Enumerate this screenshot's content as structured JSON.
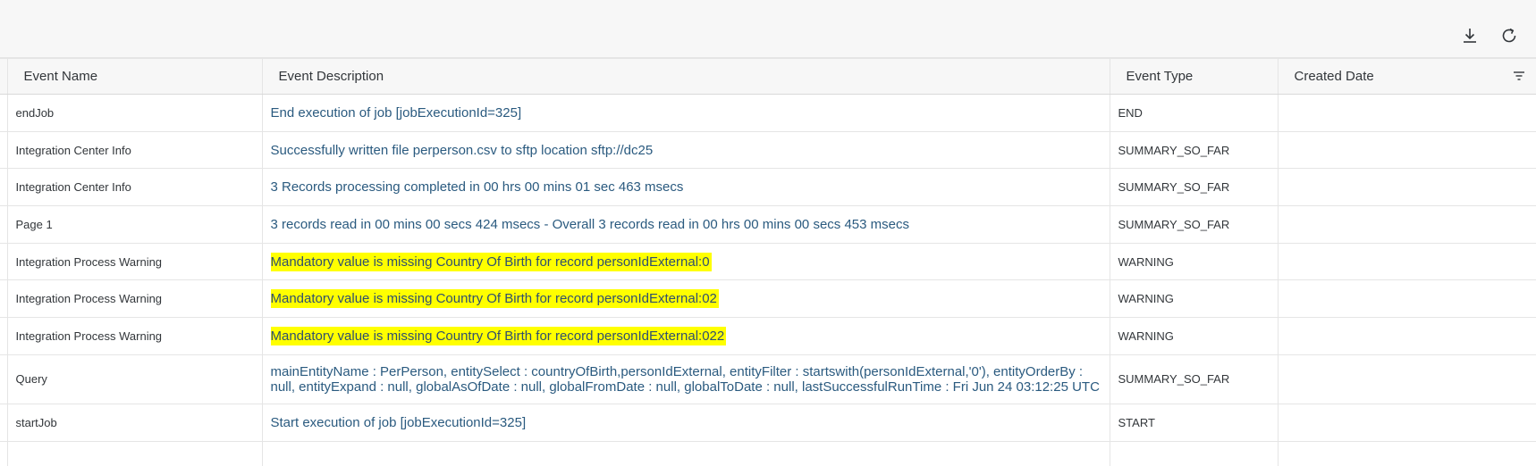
{
  "toolbar": {
    "download_icon": "download-icon",
    "refresh_icon": "refresh-icon"
  },
  "columns": {
    "event_name": "Event Name",
    "event_description": "Event Description",
    "event_type": "Event Type",
    "created_date": "Created Date"
  },
  "rows": [
    {
      "name": "endJob",
      "description": "End execution of job [jobExecutionId=325]",
      "type": "END",
      "highlighted": false
    },
    {
      "name": "Integration Center Info",
      "description": "Successfully written file perperson.csv to sftp location sftp://dc25",
      "type": "SUMMARY_SO_FAR",
      "highlighted": false
    },
    {
      "name": "Integration Center Info",
      "description": "3 Records processing completed in 00 hrs 00 mins 01 sec 463 msecs",
      "type": "SUMMARY_SO_FAR",
      "highlighted": false
    },
    {
      "name": "Page 1",
      "description": "3 records read in 00 mins 00 secs 424 msecs - Overall 3 records read in 00 hrs 00 mins 00 secs 453 msecs",
      "type": "SUMMARY_SO_FAR",
      "highlighted": false
    },
    {
      "name": "Integration Process Warning",
      "description": "Mandatory value is missing Country Of Birth for record personIdExternal:0",
      "type": "WARNING",
      "highlighted": true
    },
    {
      "name": "Integration Process Warning",
      "description": "Mandatory value is missing Country Of Birth for record personIdExternal:02",
      "type": "WARNING",
      "highlighted": true
    },
    {
      "name": "Integration Process Warning",
      "description": "Mandatory value is missing Country Of Birth for record personIdExternal:022",
      "type": "WARNING",
      "highlighted": true
    },
    {
      "name": "Query",
      "description": "mainEntityName : PerPerson, entitySelect : countryOfBirth,personIdExternal, entityFilter : startswith(personIdExternal,'0'), entityOrderBy : null, entityExpand : null, globalAsOfDate : null, globalFromDate : null, globalToDate : null, lastSuccessfulRunTime : Fri Jun 24 03:12:25 UTC",
      "type": "SUMMARY_SO_FAR",
      "highlighted": false
    },
    {
      "name": "startJob",
      "description": "Start execution of job [jobExecutionId=325]",
      "type": "START",
      "highlighted": false
    }
  ],
  "colors": {
    "highlight": "#ffff00",
    "link_text": "#2a5a7f",
    "header_bg": "#f7f7f7"
  }
}
